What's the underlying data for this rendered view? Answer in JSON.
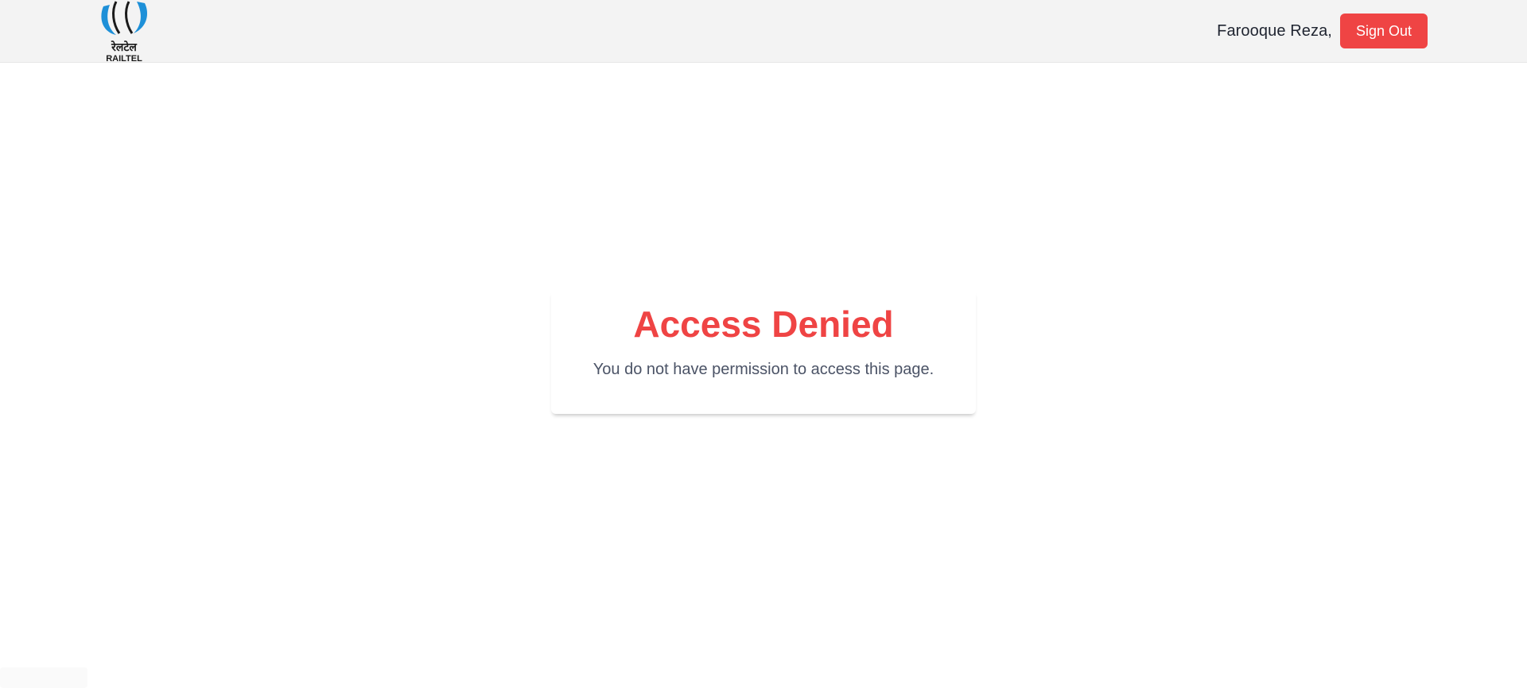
{
  "header": {
    "logo": {
      "icon": "railtel-logo",
      "hindi_text": "रेलटेल",
      "brand_text": "RAILTEL",
      "colors": {
        "blue": "#1e90d8",
        "dark": "#1a1a1a"
      }
    },
    "user_name": "Farooque Reza,",
    "signout_label": "Sign Out"
  },
  "main": {
    "title": "Access Denied",
    "message": "You do not have permission to access this page."
  },
  "colors": {
    "accent": "#ef4444",
    "header_bg": "#f3f3f3",
    "text_dark": "#1f2430",
    "text_muted": "#4b5366"
  }
}
